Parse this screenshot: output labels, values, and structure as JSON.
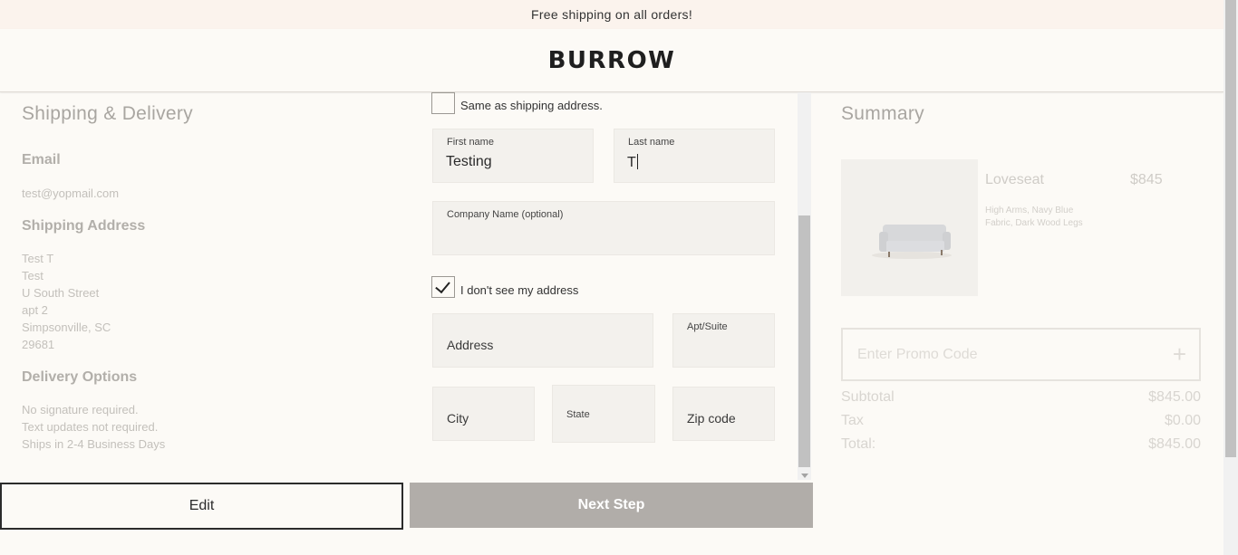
{
  "promo_bar": {
    "text": "Free shipping on all orders!"
  },
  "header": {
    "logo": "BURROW"
  },
  "left": {
    "title": "Shipping & Delivery",
    "email_heading": "Email",
    "email_value": "test@yopmail.com",
    "shipping_heading": "Shipping Address",
    "address_lines": [
      "Test T",
      "Test",
      "U South Street",
      "apt 2",
      "Simpsonville, SC",
      "29681"
    ],
    "delivery_heading": "Delivery Options",
    "delivery_lines": [
      "No signature required.",
      "Text updates not required.",
      "Ships in 2-4 Business Days"
    ]
  },
  "form": {
    "same_as_shipping": {
      "label": "Same as shipping address.",
      "checked": false
    },
    "first_name": {
      "label": "First name",
      "value": "Testing"
    },
    "last_name": {
      "label": "Last name",
      "value": "T"
    },
    "company": {
      "label": "Company Name (optional)",
      "value": ""
    },
    "no_address": {
      "label": "I don't see my address",
      "checked": true
    },
    "address": {
      "placeholder": "Address"
    },
    "apt_suite": {
      "label": "Apt/Suite"
    },
    "city": {
      "placeholder": "City"
    },
    "state": {
      "label": "State"
    },
    "zip": {
      "placeholder": "Zip code"
    }
  },
  "buttons": {
    "edit": "Edit",
    "next": "Next Step"
  },
  "summary": {
    "title": "Summary",
    "product": {
      "name": "Loveseat",
      "price": "$845",
      "desc_lines": [
        "High Arms, Navy Blue",
        "Fabric, Dark Wood Legs"
      ]
    },
    "promo_placeholder": "Enter Promo Code",
    "subtotal_label": "Subtotal",
    "subtotal_value": "$845.00",
    "tax_label": "Tax",
    "tax_value": "$0.00",
    "total_label": "Total:",
    "total_value": "$845.00"
  }
}
